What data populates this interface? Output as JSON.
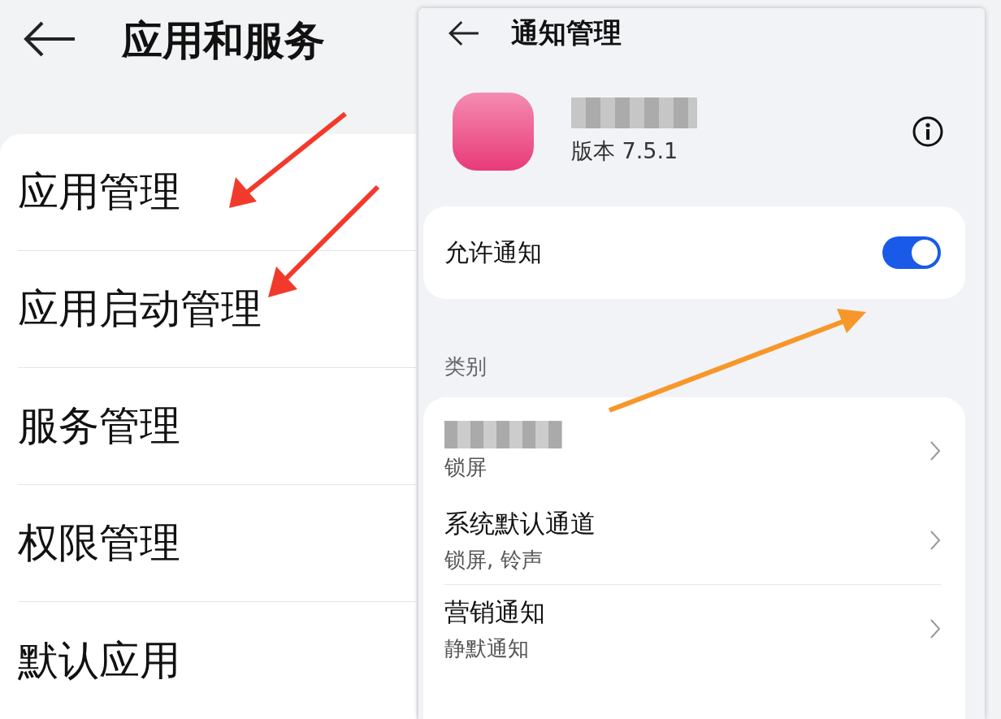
{
  "left": {
    "title": "应用和服务",
    "items": [
      {
        "label": "应用管理"
      },
      {
        "label": "应用启动管理"
      },
      {
        "label": "服务管理"
      },
      {
        "label": "权限管理"
      },
      {
        "label": "默认应用"
      }
    ]
  },
  "right": {
    "title": "通知管理",
    "app": {
      "version": "版本 7.5.1"
    },
    "allow": {
      "label": "允许通知",
      "on": true
    },
    "section": "类别",
    "categories": [
      {
        "kind": "redacted",
        "subtitle": "锁屏"
      },
      {
        "kind": "text",
        "title": "系统默认通道",
        "subtitle": "锁屏, 铃声"
      },
      {
        "kind": "text",
        "title": "营销通知",
        "subtitle": "静默通知"
      }
    ]
  }
}
